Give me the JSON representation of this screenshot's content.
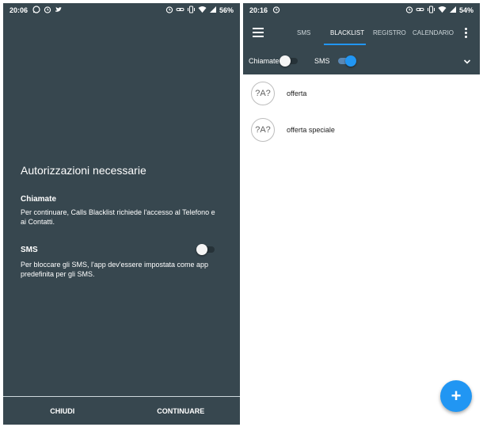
{
  "left": {
    "status": {
      "time": "20:06",
      "left_icons": [
        "whatsapp-icon",
        "alarm-icon",
        "twitter-icon"
      ],
      "right_icons": [
        "alarm-icon",
        "link-icon",
        "vibrate-icon",
        "wifi-icon",
        "signal-icon"
      ],
      "battery": "56%"
    },
    "title": "Autorizzazioni necessarie",
    "calls": {
      "heading": "Chiamate",
      "text": "Per continuare, Calls Blacklist richiede l'accesso al Telefono e ai Contatti."
    },
    "sms": {
      "heading": "SMS",
      "toggle_on": false,
      "text": "Per bloccare gli SMS, l'app dev'essere impostata come app predefinita per gli SMS."
    },
    "buttons": {
      "close": "CHIUDI",
      "continue": "CONTINUARE"
    },
    "colors": {
      "background": "#37474f"
    }
  },
  "right": {
    "status": {
      "time": "20:16",
      "left_icons": [
        "alarm-icon"
      ],
      "right_icons": [
        "alarm-icon",
        "link-icon",
        "vibrate-icon",
        "wifi-icon",
        "signal-icon"
      ],
      "battery": "54%"
    },
    "tabs": [
      {
        "label": "SMS",
        "active": false
      },
      {
        "label": "BLACKLIST",
        "active": true
      },
      {
        "label": "REGISTRO",
        "active": false
      },
      {
        "label": "CALENDARIO",
        "active": false
      }
    ],
    "filters": {
      "calls_label": "Chiamate",
      "calls_on": false,
      "sms_label": "SMS",
      "sms_on": true
    },
    "items": [
      {
        "label": "offerta",
        "icon": "text-pattern-icon",
        "avatar_text": "?A?"
      },
      {
        "label": "offerta speciale",
        "icon": "text-pattern-icon",
        "avatar_text": "?A?"
      }
    ],
    "fab": {
      "label": "+",
      "icon": "add-icon"
    },
    "colors": {
      "appbar": "#37474f",
      "accent": "#2196f3"
    }
  }
}
